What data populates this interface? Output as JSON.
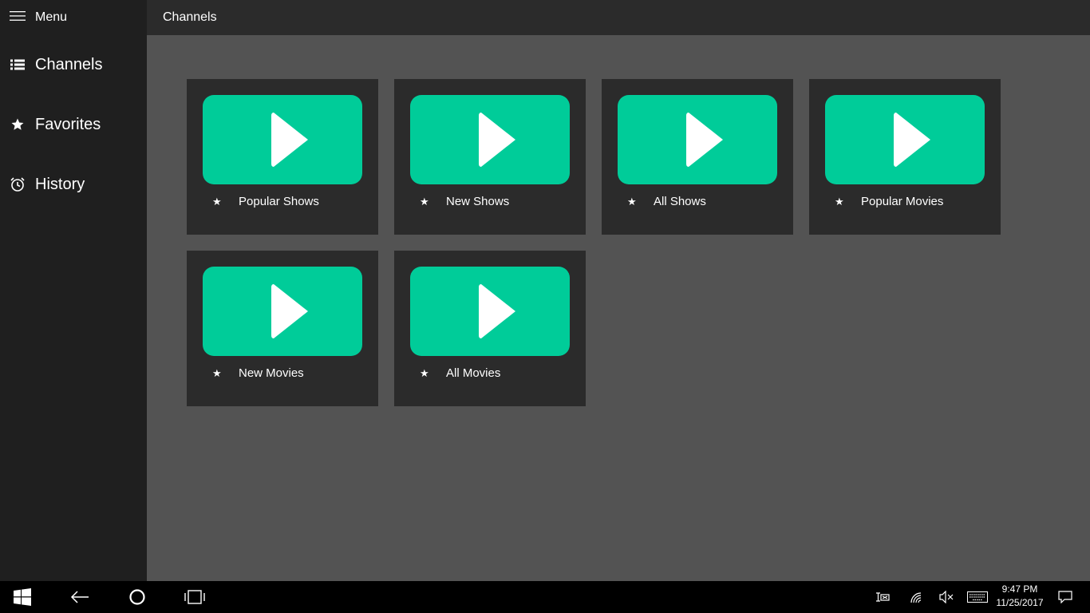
{
  "sidebar": {
    "menu_label": "Menu",
    "items": [
      {
        "label": "Channels",
        "icon": "list-icon"
      },
      {
        "label": "Favorites",
        "icon": "star-icon"
      },
      {
        "label": "History",
        "icon": "history-icon"
      }
    ]
  },
  "header": {
    "title": "Channels"
  },
  "tiles": [
    {
      "label": "Popular Shows"
    },
    {
      "label": "New Shows"
    },
    {
      "label": "All Shows"
    },
    {
      "label": "Popular Movies"
    },
    {
      "label": "New Movies"
    },
    {
      "label": "All Movies"
    }
  ],
  "taskbar": {
    "time": "9:47 PM",
    "date": "11/25/2017"
  },
  "colors": {
    "accent": "#00cc99",
    "sidebar_bg": "#1f1f1f",
    "header_bg": "#2b2b2b",
    "content_bg": "#535353",
    "tile_bg": "#2b2b2b"
  }
}
